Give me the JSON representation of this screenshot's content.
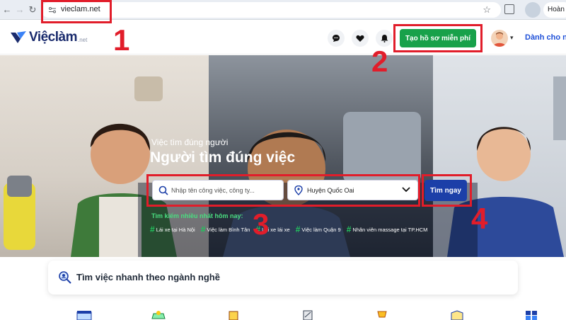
{
  "browser": {
    "url": "vieclam.net",
    "profile_label": "Hoàn t"
  },
  "header": {
    "brand": "Việclàm",
    "brand_tld": ".net",
    "cta_label": "Tạo hồ sơ miễn phí",
    "employer_link": "Dành cho nhà"
  },
  "hero": {
    "subtitle": "Việc tìm đúng người",
    "title": "Người tìm đúng việc",
    "search_placeholder": "Nhập tên công việc, công ty...",
    "location_value": "Huyện Quốc Oai",
    "search_button": "Tìm ngay",
    "popular_label": "Tìm kiếm nhiều nhất hôm nay:",
    "popular_tags": [
      "Lái xe tại Hà Nội",
      "Việc làm Bình Tân",
      "Lái xe lái xe",
      "Việc làm Quận 9",
      "Nhân viên massage tại TP.HCM"
    ]
  },
  "section": {
    "title": "Tìm việc nhanh theo ngành nghề"
  },
  "annotations": [
    "1",
    "2",
    "3",
    "4"
  ],
  "colors": {
    "brand": "#1a2b6d",
    "cta": "#18a14a",
    "search_button": "#1c3fa8",
    "annotation": "#e11d2a",
    "tag_hash": "#22c55e"
  }
}
